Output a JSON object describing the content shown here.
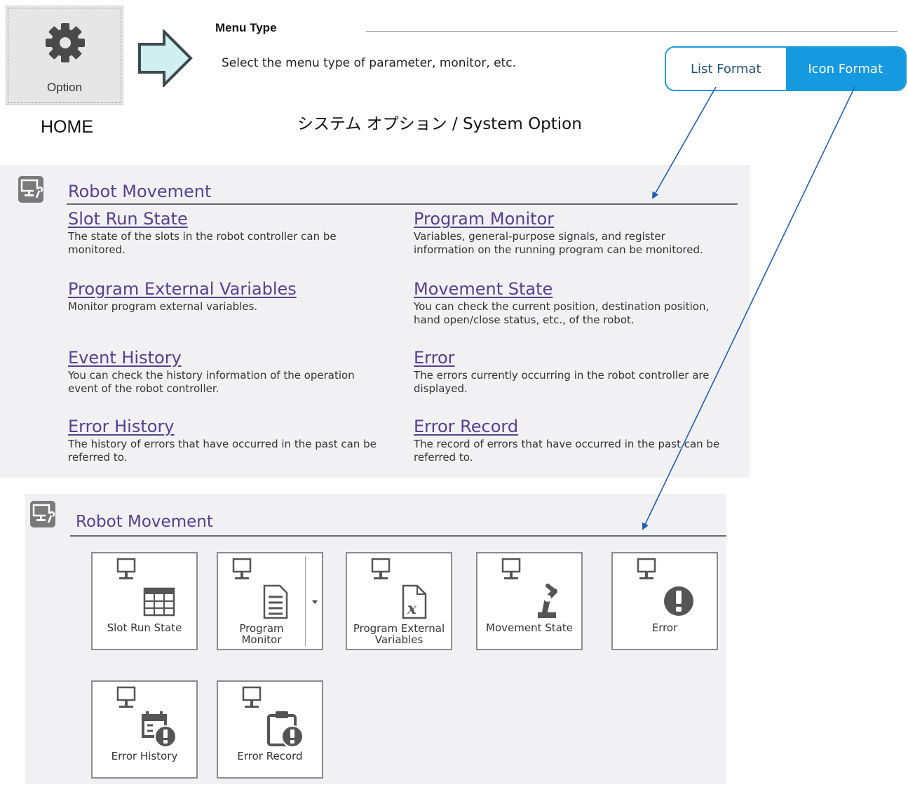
{
  "option_tile": {
    "label": "Option",
    "icon": "gear-icon"
  },
  "home_caption": "HOME",
  "menu_type": {
    "title": "Menu Type",
    "description": "Select the menu type of parameter, monitor, etc."
  },
  "format_toggle": {
    "list_label": "List Format",
    "icon_label": "Icon Format",
    "selected": "Icon Format",
    "accent": "#159ae0"
  },
  "system_option_caption": "システム オプション / System Option",
  "list_view": {
    "section_title": "Robot Movement",
    "section_icon": "monitor-wrench-icon",
    "items": [
      {
        "title": "Slot Run State",
        "desc": "The state of the slots in the robot controller can be monitored."
      },
      {
        "title": "Program Monitor",
        "desc": "Variables, general-purpose signals, and register information on the running program can be monitored."
      },
      {
        "title": "Program External Variables",
        "desc": "Monitor program external variables."
      },
      {
        "title": "Movement State",
        "desc": "You can check the current position, destination position, hand open/close status, etc., of the robot."
      },
      {
        "title": "Event History",
        "desc": "You can check the history information of the operation event of the robot controller."
      },
      {
        "title": "Error",
        "desc": "The errors currently occurring in the robot controller are displayed."
      },
      {
        "title": "Error History",
        "desc": "The history of errors that have occurred in the past can be referred to."
      },
      {
        "title": "Error Record",
        "desc": "The record of errors that have occurred in the past can be referred to."
      }
    ]
  },
  "icon_view": {
    "section_title": "Robot Movement",
    "section_icon": "monitor-wrench-icon",
    "tiles": [
      {
        "label": "Slot Run State",
        "icon": "table-icon"
      },
      {
        "label": "Program Monitor",
        "icon": "document-icon",
        "has_dropdown": true
      },
      {
        "label": "Program External Variables",
        "icon": "variable-file-icon"
      },
      {
        "label": "Movement State",
        "icon": "robot-arm-icon"
      },
      {
        "label": "Error",
        "icon": "error-icon"
      },
      {
        "label": "Error History",
        "icon": "calendar-error-icon"
      },
      {
        "label": "Error Record",
        "icon": "clipboard-error-icon"
      }
    ]
  },
  "colors": {
    "link": "#57408f",
    "panel_background": "#f1f1f4",
    "annotation_arrow": "#1f5fb0"
  }
}
